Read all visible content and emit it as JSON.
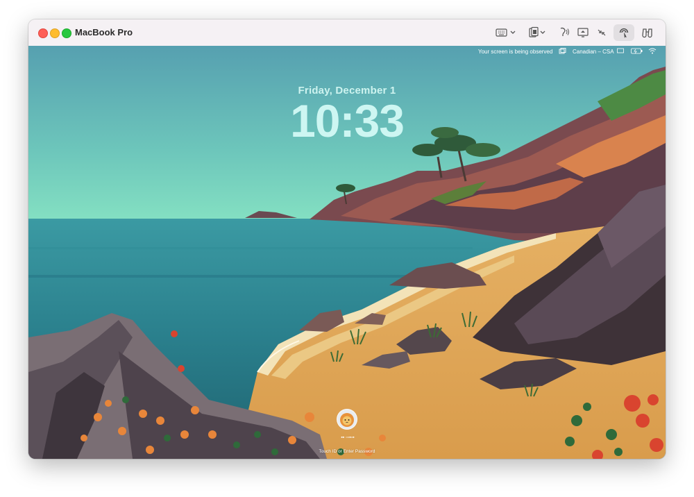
{
  "window": {
    "title": "MacBook Pro",
    "toolbar_icons": [
      "keyboard-icon",
      "clipboard-icon",
      "accessibility-icon",
      "screen-icon",
      "shrink-icon",
      "control-icon",
      "binoculars-icon"
    ]
  },
  "menubar": {
    "observed_text": "Your screen is being observed",
    "input_source": "Canadian – CSA"
  },
  "lockscreen": {
    "date": "Friday, December 1",
    "time": "10:33",
    "username": "▪▪ ▫▫▪▫▪",
    "hint": "Touch ID or Enter Password"
  },
  "colors": {
    "sky_top": "#5ca6b3",
    "sky_bottom": "#7ad8bd",
    "sea": "#2e8a96",
    "sand": "#e2a85a",
    "rock": "#5a4a56"
  }
}
